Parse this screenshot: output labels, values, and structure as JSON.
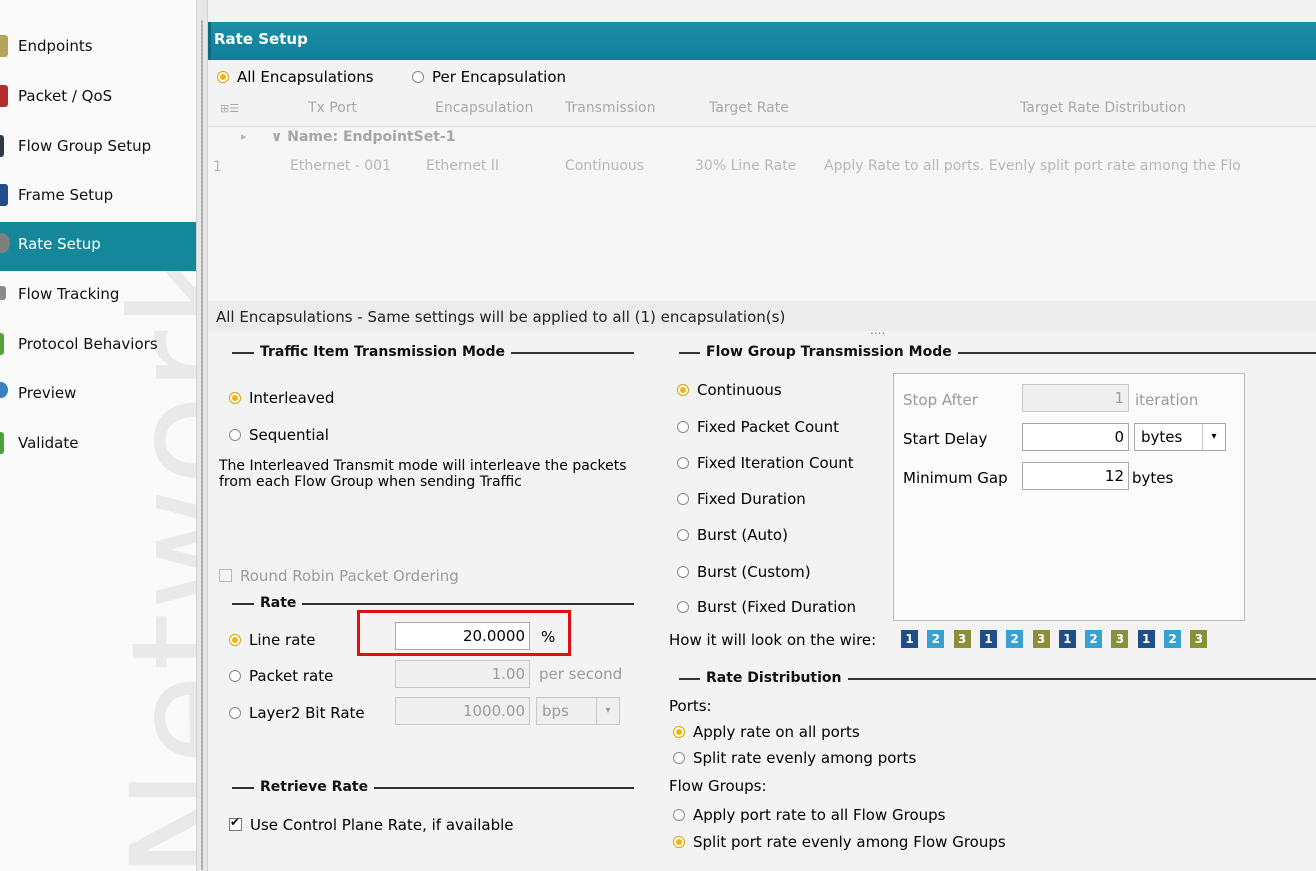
{
  "sidebar": {
    "watermark": "Network",
    "items": [
      {
        "label": "Endpoints",
        "icon": "endpoints-icon",
        "color": "#b7a25a"
      },
      {
        "label": "Packet / QoS",
        "icon": "packet-icon",
        "color": "#b02d2d"
      },
      {
        "label": "Flow Group Setup",
        "icon": "flow-group-icon",
        "color": "#2f3a44"
      },
      {
        "label": "Frame Setup",
        "icon": "frame-icon",
        "color": "#214f8c"
      },
      {
        "label": "Rate Setup",
        "icon": "rate-icon",
        "color": "#7f7f7f",
        "active": true
      },
      {
        "label": "Flow Tracking",
        "icon": "tracking-icon",
        "color": "#8a8a8a"
      },
      {
        "label": "Protocol Behaviors",
        "icon": "protocol-icon",
        "color": "#5aa03a"
      },
      {
        "label": "Preview",
        "icon": "preview-icon",
        "color": "#3a7fc4"
      },
      {
        "label": "Validate",
        "icon": "validate-icon",
        "color": "#4aa33a"
      }
    ]
  },
  "header": {
    "title": "Rate Setup"
  },
  "encap": {
    "all": "All Encapsulations",
    "per": "Per Encapsulation"
  },
  "grid": {
    "columns": [
      "Tx Port",
      "Encapsulation",
      "Transmission",
      "Target Rate",
      "Target Rate Distribution"
    ],
    "group": "Name: EndpointSet-1",
    "rows": [
      {
        "num": "1",
        "tx_port": "Ethernet - 001",
        "encap": "Ethernet II",
        "transmission": "Continuous",
        "target_rate": "30% Line Rate",
        "distribution": "Apply Rate to all ports. Evenly split port rate among the Flo"
      }
    ]
  },
  "status": "All Encapsulations - Same settings will be applied to all (1) encapsulation(s)",
  "traffic_mode": {
    "title": "Traffic Item Transmission Mode",
    "interleaved": "Interleaved",
    "sequential": "Sequential",
    "description": "The Interleaved Transmit mode will interleave the packets from each Flow Group when sending Traffic",
    "round_robin": "Round Robin Packet Ordering"
  },
  "rate": {
    "title": "Rate",
    "line_rate": "Line rate",
    "line_rate_value": "20.0000",
    "line_rate_unit": "%",
    "packet_rate": "Packet rate",
    "packet_rate_value": "1.00",
    "packet_rate_unit": "per second",
    "l2_bit_rate": "Layer2 Bit Rate",
    "l2_bit_rate_value": "1000.00",
    "l2_bit_rate_unit": "bps"
  },
  "retrieve": {
    "title": "Retrieve Rate",
    "use_cp": "Use Control Plane Rate, if available"
  },
  "flow_mode": {
    "title": "Flow Group Transmission Mode",
    "options": [
      "Continuous",
      "Fixed Packet Count",
      "Fixed Iteration Count",
      "Fixed Duration",
      "Burst (Auto)",
      "Burst (Custom)",
      "Burst (Fixed Duration"
    ],
    "stop_after_label": "Stop After",
    "stop_after_value": "1",
    "stop_after_unit": "iteration",
    "start_delay_label": "Start Delay",
    "start_delay_value": "0",
    "start_delay_unit": "bytes",
    "min_gap_label": "Minimum Gap",
    "min_gap_value": "12",
    "min_gap_unit": "bytes",
    "wire_label": "How it will look on the wire:",
    "wire_pattern": [
      "1",
      "2",
      "3",
      "1",
      "2",
      "3",
      "1",
      "2",
      "3",
      "1",
      "2",
      "3"
    ]
  },
  "distribution": {
    "title": "Rate Distribution",
    "ports_label": "Ports:",
    "ports_all": "Apply rate on all ports",
    "ports_split": "Split rate evenly among ports",
    "fg_label": "Flow Groups:",
    "fg_all": "Apply port rate to all Flow Groups",
    "fg_split": "Split port rate evenly among Flow Groups"
  },
  "colors": {
    "accent": "#15879a",
    "highlight": "#e01010",
    "radio": "#f4b300"
  }
}
